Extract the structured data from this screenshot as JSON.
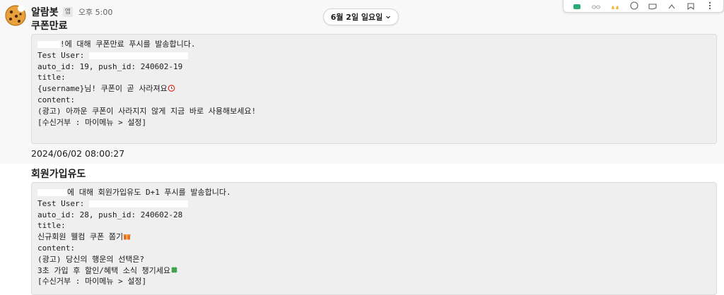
{
  "channel": {
    "date_divider": "6월 2일 일요일"
  },
  "message": {
    "sender": "알람봇",
    "app_badge": "앱",
    "time": "오후 5:00"
  },
  "block1": {
    "title": "쿠폰만료",
    "lines": [
      "!에 대해 쿠폰만료 푸시를 발송합니다.",
      "Test User:",
      "auto_id: 19, push_id: 240602-19",
      "title:",
      "{username}님! 쿠폰이 곧 사라져요",
      "content:",
      "(광고) 아까운 쿠폰이 사라지지 않게 지금 바로 사용해보세요!",
      "[수신거부 : 마이메뉴 > 설정]"
    ],
    "timestamp": "2024/06/02 08:00:27"
  },
  "block2": {
    "title": "회원가입유도",
    "lines": [
      "에 대해 회원가입유도 D+1 푸시를 발송합니다.",
      "Test User:",
      "auto_id: 28, push_id: 240602-28",
      "title:",
      "신규회원 웰컴 쿠폰 쫌기",
      "content:",
      "(광고) 당신의 행운의 선택은?",
      "3초 가입 후 할인/혜택 소식 챙기세요",
      "[수신거부 : 마이메뉴 > 설정]"
    ]
  },
  "icons": {
    "avatar": "cookie-icon",
    "date_chevron": "chevron-down-icon",
    "toolbar": [
      "check-reaction-icon",
      "eyes-reaction-icon",
      "raised-hands-reaction-icon",
      "emoji-add-icon",
      "reply-thread-icon",
      "forward-icon",
      "bookmark-icon",
      "more-icon"
    ]
  },
  "colors": {
    "message_bg": "#f8f8f8",
    "code_bg": "#efefef",
    "code_border": "#dcdcdc",
    "text": "#1d1c1d",
    "muted": "#616061"
  }
}
